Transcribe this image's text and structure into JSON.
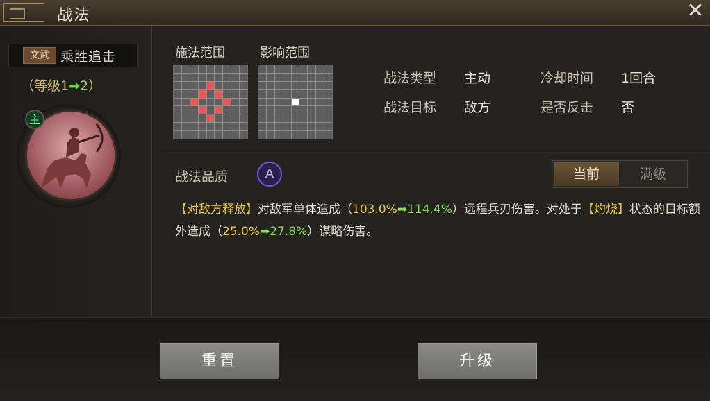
{
  "window": {
    "title": "战法",
    "close_icon": "close-icon"
  },
  "left": {
    "tag": "文武",
    "skill_name": "乘胜追击",
    "level": {
      "open": "（等级",
      "from": "1",
      "to": "2",
      "close": "）"
    },
    "portrait_badge": "主"
  },
  "ranges": {
    "cast_label": "施法范围",
    "effect_label": "影响范围"
  },
  "props": {
    "type_label": "战法类型",
    "type_value": "主动",
    "cooldown_label": "冷却时间",
    "cooldown_value": "1回合",
    "target_label": "战法目标",
    "target_value": "敌方",
    "counter_label": "是否反击",
    "counter_value": "否"
  },
  "quality": {
    "label": "战法品质",
    "grade": "A"
  },
  "toggle": {
    "current": "当前",
    "max": "满级"
  },
  "description": {
    "trigger": "【对敌方释放】",
    "t1": "对敌军单体造成（",
    "v1_from": "103.0%",
    "v1_to": "114.4%",
    "t2": "）远程兵刃伤害。对处于",
    "status": "【灼烧】",
    "t3": "状态的目标额外造成（",
    "v2_from": "25.0%",
    "v2_to": "27.8%",
    "t4": "）谋略伤害。"
  },
  "buttons": {
    "reset": "重置",
    "upgrade": "升级"
  },
  "colors": {
    "accent_gold": "#f0c93c",
    "accent_green": "#8fdc5c",
    "grid_red": "#e25a55"
  }
}
